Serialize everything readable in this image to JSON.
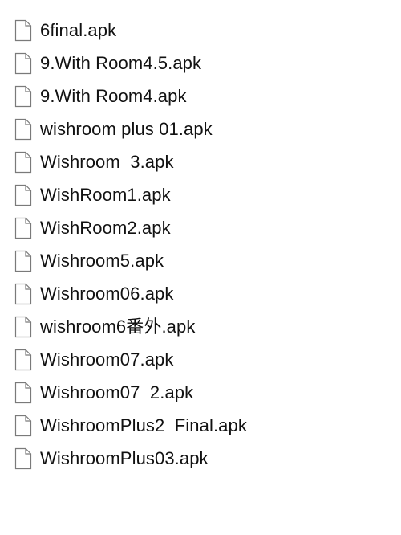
{
  "files": [
    {
      "name": "6final.apk",
      "icon": "document-icon"
    },
    {
      "name": "9.With Room4.5.apk",
      "icon": "document-icon"
    },
    {
      "name": "9.With Room4.apk",
      "icon": "document-icon"
    },
    {
      "name": "wishroom plus 01.apk",
      "icon": "document-icon"
    },
    {
      "name": "Wishroom  3.apk",
      "icon": "document-icon"
    },
    {
      "name": "WishRoom1.apk",
      "icon": "document-icon"
    },
    {
      "name": "WishRoom2.apk",
      "icon": "document-icon"
    },
    {
      "name": "Wishroom5.apk",
      "icon": "document-icon"
    },
    {
      "name": "Wishroom06.apk",
      "icon": "document-icon"
    },
    {
      "name": "wishroom6番外.apk",
      "icon": "document-icon"
    },
    {
      "name": "Wishroom07.apk",
      "icon": "document-icon"
    },
    {
      "name": "Wishroom07  2.apk",
      "icon": "document-icon"
    },
    {
      "name": "WishroomPlus2  Final.apk",
      "icon": "document-icon"
    },
    {
      "name": "WishroomPlus03.apk",
      "icon": "document-icon"
    }
  ]
}
